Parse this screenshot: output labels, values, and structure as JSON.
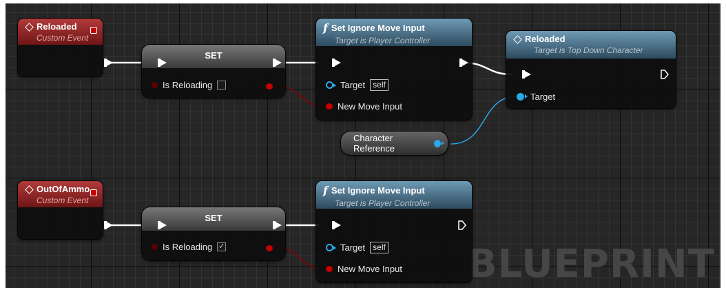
{
  "watermark": "BLUEPRINT",
  "colors": {
    "event_header": "#b13a3a",
    "function_header": "#4b7490",
    "exec_pin": "#ffffff",
    "bool_pin": "#c40000",
    "object_pin": "#2aa8e8",
    "grid_bg": "#262626"
  },
  "nodes": {
    "reloaded_event": {
      "title": "Reloaded",
      "subtitle": "Custom Event",
      "icon": "event-diamond-icon"
    },
    "set_1": {
      "title": "SET",
      "var_label": "Is Reloading",
      "checked": false
    },
    "set_ignore_1": {
      "title": "Set Ignore Move Input",
      "subtitle": "Target is Player Controller",
      "target_label": "Target",
      "target_value": "self",
      "input_label": "New Move Input",
      "icon": "function-icon"
    },
    "reloaded_call": {
      "title": "Reloaded",
      "subtitle": "Target is Top Down Character",
      "target_label": "Target",
      "icon": "event-diamond-icon"
    },
    "character_ref": {
      "label": "Character Reference"
    },
    "outofammo_event": {
      "title": "OutOfAmmo",
      "subtitle": "Custom Event",
      "icon": "event-diamond-icon"
    },
    "set_2": {
      "title": "SET",
      "var_label": "Is Reloading",
      "checked": true,
      "check_glyph": "✓"
    },
    "set_ignore_2": {
      "title": "Set Ignore Move Input",
      "subtitle": "Target is Player Controller",
      "target_label": "Target",
      "target_value": "self",
      "input_label": "New Move Input",
      "icon": "function-icon"
    }
  }
}
